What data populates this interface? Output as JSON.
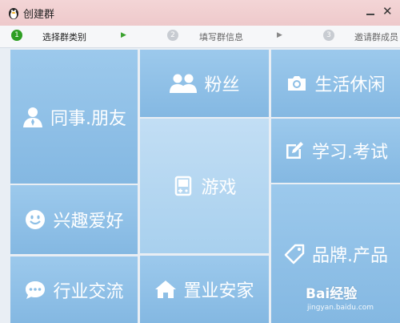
{
  "window": {
    "title": "创建群"
  },
  "steps": [
    {
      "num": "1",
      "label": "选择群类别",
      "active": true
    },
    {
      "num": "2",
      "label": "填写群信息",
      "active": false
    },
    {
      "num": "3",
      "label": "邀请群成员",
      "active": false
    }
  ],
  "categories": {
    "coworkers_friends": "同事.朋友",
    "fans": "粉丝",
    "life_leisure": "生活休闲",
    "games": "游戏",
    "study_exam": "学习.考试",
    "hobbies": "兴趣爱好",
    "brand_product": "品牌.产品",
    "industry_exchange": "行业交流",
    "home_property": "置业安家"
  },
  "watermark": {
    "logo": "Bai经验",
    "url": "jingyan.baidu.com"
  },
  "colors": {
    "tile": "#8dbfe6",
    "tile_light": "#b3d6f0",
    "titlebar": "#f0cfd0",
    "step_active": "#2e9e23"
  }
}
